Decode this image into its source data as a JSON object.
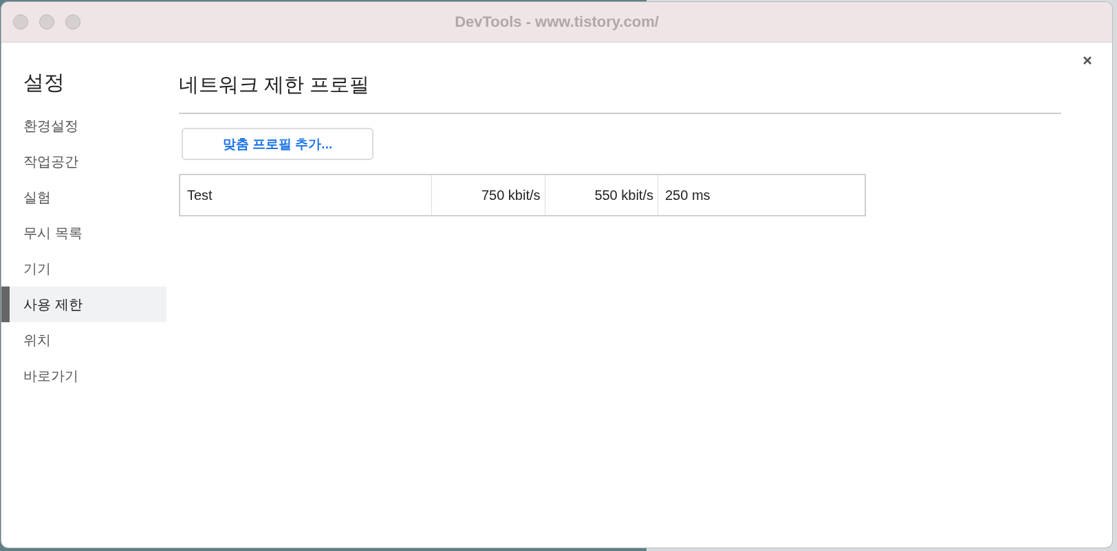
{
  "window": {
    "title": "DevTools - www.tistory.com/"
  },
  "sidebar": {
    "title": "설정",
    "items": [
      {
        "label": "환경설정",
        "selected": false
      },
      {
        "label": "작업공간",
        "selected": false
      },
      {
        "label": "실험",
        "selected": false
      },
      {
        "label": "무시 목록",
        "selected": false
      },
      {
        "label": "기기",
        "selected": false
      },
      {
        "label": "사용 제한",
        "selected": true
      },
      {
        "label": "위치",
        "selected": false
      },
      {
        "label": "바로가기",
        "selected": false
      }
    ]
  },
  "content": {
    "title": "네트워크 제한 프로필",
    "add_button": "맞춤 프로필 추가...",
    "table": {
      "rows": [
        {
          "cells": [
            "Test",
            "750 kbit/s",
            "550 kbit/s",
            "250 ms"
          ]
        }
      ]
    }
  }
}
